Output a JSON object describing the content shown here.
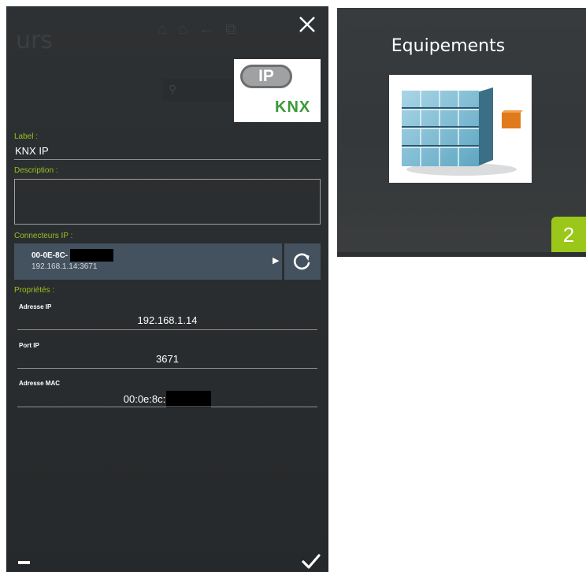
{
  "panel": {
    "background_title": "urs",
    "close_icon": "close-icon",
    "device_logo": {
      "badge": "IP",
      "brand": "KNX"
    },
    "label": {
      "caption": "Label :",
      "value": "KNX IP"
    },
    "description": {
      "caption": "Description :",
      "value": ""
    },
    "connectors": {
      "caption": "Connecteurs IP :",
      "selected_name": "00-0E-8C-",
      "selected_address": "192.168.1.14:3671",
      "arrow_icon": "play-arrow-icon",
      "refresh_icon": "refresh-icon"
    },
    "properties": {
      "caption": "Propriétés :",
      "ip": {
        "label": "Adresse IP",
        "value": "192.168.1.14"
      },
      "port": {
        "label": "Port IP",
        "value": "3671"
      },
      "mac": {
        "label": "Adresse MAC",
        "value": "00:0e:8c:"
      }
    },
    "footer": {
      "minus_icon": "minus-icon",
      "check_icon": "check-icon"
    }
  },
  "tile": {
    "title": "Equipements",
    "badge": "2",
    "accent_color": "#9bc61a"
  },
  "colors": {
    "accent_green": "#9ac11e",
    "panel_bg": "#2b2e30",
    "selection_bg": "#44525f"
  }
}
